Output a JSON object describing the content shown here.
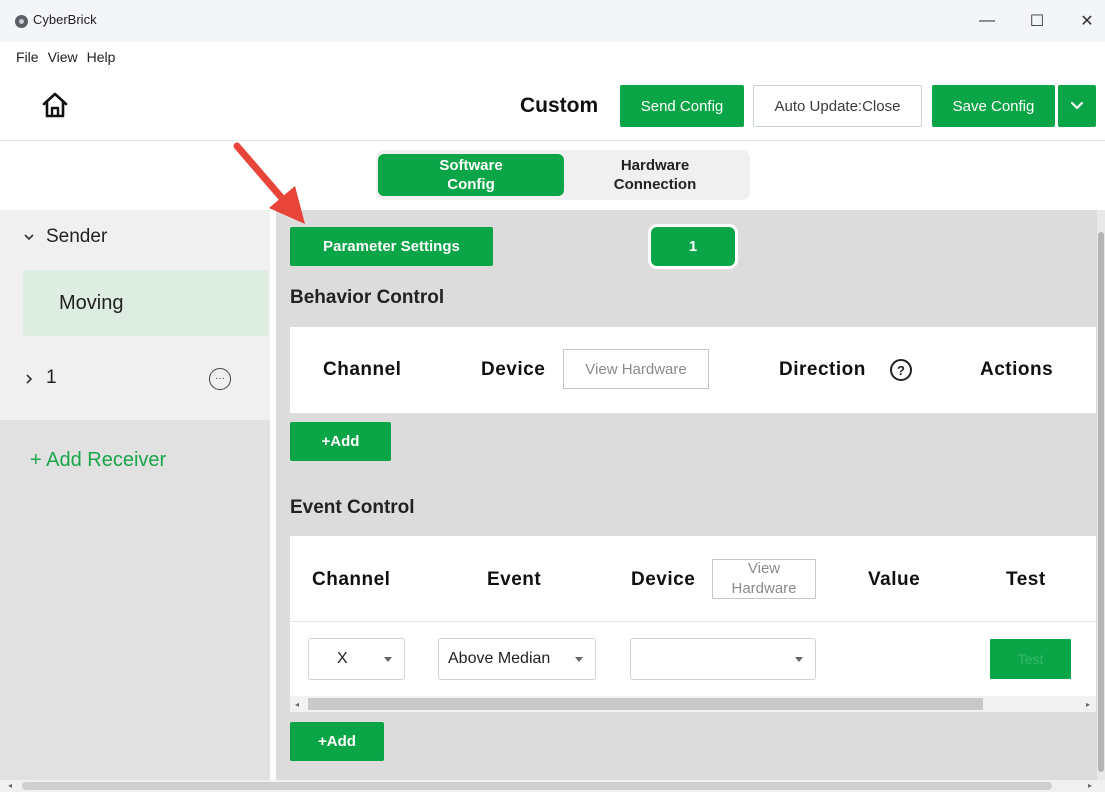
{
  "window": {
    "title": "CyberBrick",
    "controls": [
      "—",
      "☐",
      "✕"
    ],
    "menu": [
      "File",
      "View",
      "Help"
    ]
  },
  "header": {
    "title": "Custom",
    "send_config": "Send Config",
    "auto_update": "Auto Update:Close",
    "save_config": "Save Config"
  },
  "mode_tabs": {
    "software": [
      "Software",
      "Config"
    ],
    "hardware": [
      "Hardware",
      "Connection"
    ]
  },
  "sidebar": {
    "sender": "Sender",
    "sender_item": "Moving",
    "receiver": "1",
    "receiver_more": "···",
    "add_receiver": "+ Add Receiver"
  },
  "main": {
    "parameter_settings": "Parameter Settings",
    "page_badge": "1",
    "behavior": {
      "title": "Behavior Control",
      "columns": {
        "channel": "Channel",
        "device": "Device",
        "view_hardware": "View Hardware",
        "direction": "Direction",
        "direction_help": "?",
        "actions": "Actions"
      },
      "add": "+Add"
    },
    "event": {
      "title": "Event Control",
      "columns": {
        "channel": "Channel",
        "event": "Event",
        "device": "Device",
        "view_hardware": [
          "View",
          "Hardware"
        ],
        "value": "Value",
        "test": "Test"
      },
      "row": {
        "channel": "X",
        "event": "Above Median",
        "device": "",
        "test": "Test"
      },
      "add": "+Add"
    }
  },
  "colors": {
    "accent": "#0aa546",
    "annotation": "#e8443a"
  },
  "icons": [
    "app-logo-icon",
    "home-icon",
    "chevron-down-icon",
    "chevron-right-icon",
    "more-icon",
    "help-circle-icon",
    "dropdown-caret-icon"
  ]
}
